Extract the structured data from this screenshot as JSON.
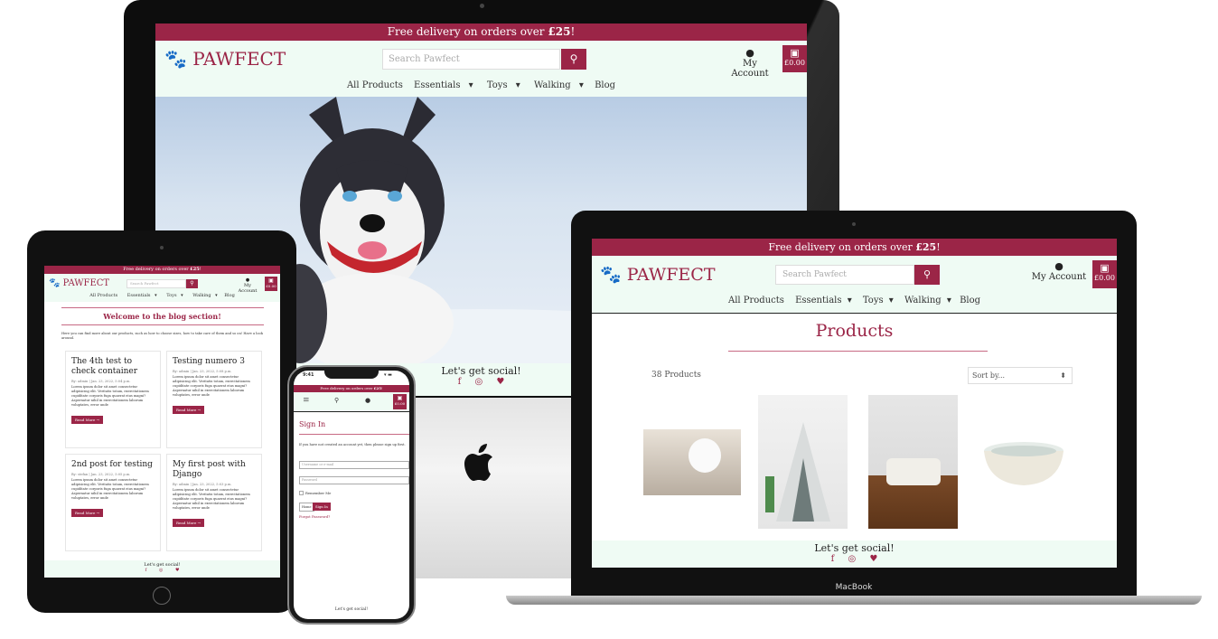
{
  "site": {
    "promo_text": "Free delivery on orders over ",
    "promo_amount": "£25",
    "promo_end": "!",
    "logo_text": "PAWFECT",
    "search_placeholder": "Search Pawfect",
    "account_label": "My Account",
    "bag_total": "£0.00",
    "nav": [
      "All Products",
      "Essentials",
      "Toys",
      "Walking",
      "Blog"
    ],
    "social_heading": "Let's get social!"
  },
  "products_page": {
    "title": "Products",
    "count": "38 Products",
    "sort_label": "Sort by..."
  },
  "blog_page": {
    "title": "Welcome to the blog section!",
    "intro": "Here you can find more about our products, such as how to choose sizes, how to take care of them and so on! Have a look around.",
    "read_more": "Read More →",
    "posts": [
      {
        "title": "The 4th test to check container",
        "meta": "By: admin | Jan. 23, 2022, 5:04 p.m.",
        "body": "Lorem ipsum dolor sit amet consectetur adipisicing elit. Veritatis totam, exercitationem cupiditate corporis fuga quaerat eius magni? Aspernatur nihil in exercitationem laborum voluptates, error unde"
      },
      {
        "title": "Testing numero 3",
        "meta": "By: admin | Jan. 23, 2022, 5:08 p.m.",
        "body": "Lorem ipsum dolor sit amet consectetur adipisicing elit. Veritatis totam, exercitationem cupiditate corporis fuga quaerat eius magni? Aspernatur nihil in exercitationem laborum voluptates, error unde"
      },
      {
        "title": "2nd post for testing",
        "meta": "By: stefan | Jan. 23, 2022, 5:05 p.m.",
        "body": "Lorem ipsum dolor sit amet consectetur adipisicing elit. Veritatis totam, exercitationem cupiditate corporis fuga quaerat eius magni? Aspernatur nihil in exercitationem laborum voluptates, error unde"
      },
      {
        "title": "My first post with Django",
        "meta": "By: admin | Jan. 23, 2022, 5:03 p.m.",
        "body": "Lorem ipsum dolor sit amet consectetur adipisicing elit. Veritatis totam, exercitationem cupiditate corporis fuga quaerat eius magni? Aspernatur nihil in exercitationem laborum voluptates, error unde"
      }
    ]
  },
  "signin_page": {
    "status_time": "9:41",
    "title": "Sign In",
    "intro": "If you have not created an account yet, then please sign up first.",
    "username_placeholder": "Username or e-mail",
    "password_placeholder": "Password",
    "remember_label": "Remember Me",
    "home_button": "Home",
    "signin_button": "Sign In",
    "forgot_link": "Forgot Password?"
  },
  "devices": {
    "laptop_label": "MacBook"
  },
  "icons": [
    "paw-icon",
    "search-icon",
    "user-icon",
    "bag-icon",
    "facebook-icon",
    "instagram-icon",
    "twitter-icon",
    "apple-logo-icon",
    "hamburger-icon",
    "caret-down-icon"
  ],
  "colors": {
    "accent": "#9b2547",
    "header_bg": "#effbf4",
    "text": "#333333"
  }
}
